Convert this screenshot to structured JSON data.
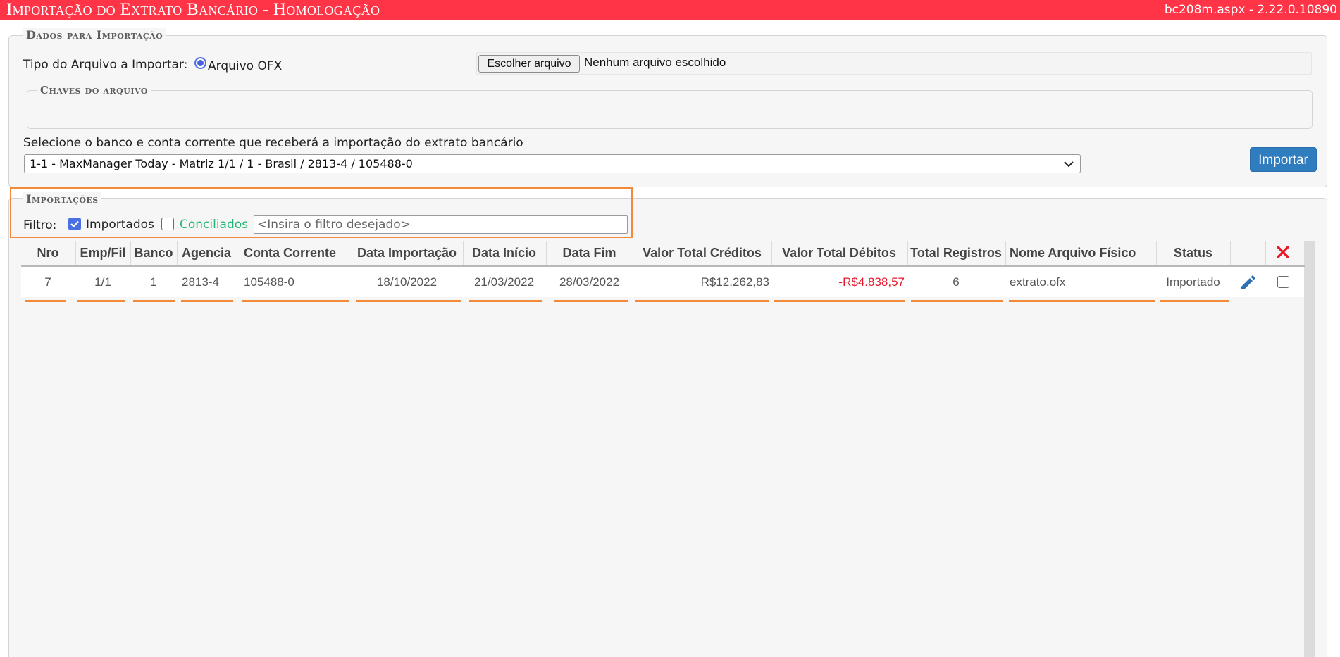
{
  "titlebar": {
    "title": "Importação do Extrato Bancário  - Homologação",
    "version": "bc208m.aspx - 2.22.0.10890"
  },
  "dados": {
    "legend": "Dados para Importação",
    "tipo_label": "Tipo do Arquivo a Importar:",
    "radio_label": "Arquivo OFX",
    "file_button": "Escolher arquivo",
    "file_status": "Nenhum arquivo escolhido",
    "chaves_legend": "Chaves do arquivo",
    "select_label": "Selecione o banco e conta corrente que receberá a importação do extrato bancário",
    "select_value": "1-1 - MaxManager Today - Matriz 1/1 / 1 - Brasil / 2813-4 / 105488-0",
    "import_button": "Importar"
  },
  "importacoes": {
    "legend": "Importações",
    "filtro_label": "Filtro:",
    "importados_label": "Importados",
    "importados_checked": true,
    "conciliados_label": "Conciliados",
    "conciliados_checked": false,
    "conciliados_color": "#22b573",
    "filter_placeholder": "<Insira o filtro desejado>"
  },
  "table": {
    "headers": {
      "nro": "Nro",
      "empfil": "Emp/Fil",
      "banco": "Banco",
      "agencia": "Agencia",
      "conta": "Conta Corrente",
      "data_importacao": "Data Importação",
      "data_inicio": "Data Início",
      "data_fim": "Data Fim",
      "valor_creditos": "Valor Total Créditos",
      "valor_debitos": "Valor Total Débitos",
      "total_registros": "Total Registros",
      "nome_arquivo": "Nome Arquivo Físico",
      "status": "Status"
    },
    "rows": [
      {
        "nro": "7",
        "empfil": "1/1",
        "banco": "1",
        "agencia": "2813-4",
        "conta": "105488-0",
        "data_importacao": "18/10/2022",
        "data_inicio": "21/03/2022",
        "data_fim": "28/03/2022",
        "valor_creditos": "R$12.262,83",
        "valor_debitos": "-R$4.838,57",
        "total_registros": "6",
        "nome_arquivo": "extrato.ofx",
        "status": "Importado"
      }
    ]
  },
  "colors": {
    "titlebar": "#ff3447",
    "accent_orange": "#f28a3a",
    "button_blue": "#2f7cbf",
    "negative": "#e8192c",
    "delete_icon": "#e8192c",
    "edit_icon": "#2f6fb3"
  },
  "icons": {
    "delete": "close-icon",
    "edit": "pencil-icon",
    "select_arrow": "chevron-down-icon"
  }
}
